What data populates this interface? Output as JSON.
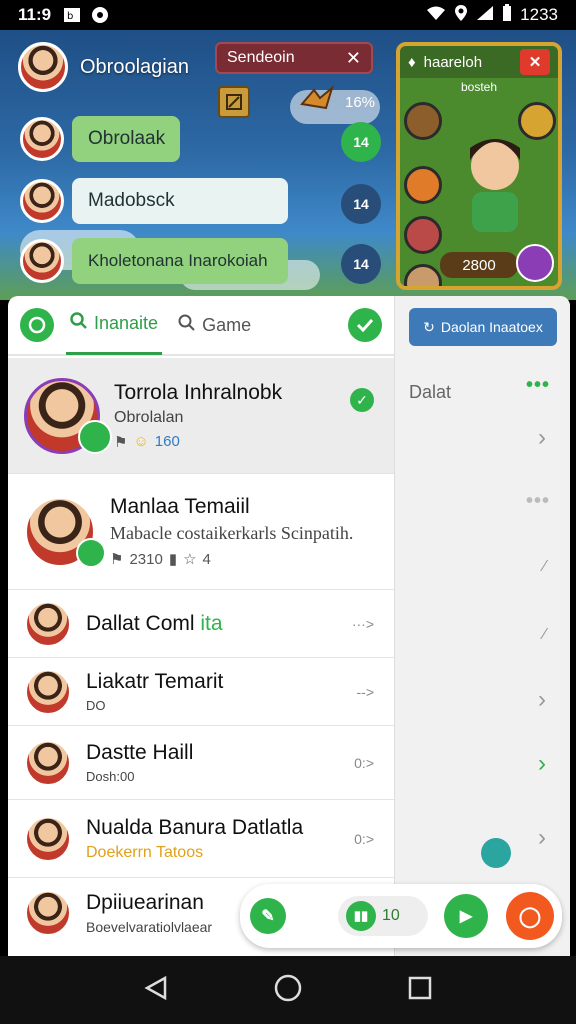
{
  "status_bar": {
    "time": "11:9",
    "right_text": "1233",
    "icons": [
      "app-icon",
      "circle-dot-icon",
      "wifi-icon",
      "location-icon",
      "signal-icon",
      "battery-icon"
    ]
  },
  "game": {
    "profile_name": "Obroolagian",
    "session_label": "Sendeoin",
    "percent": "16%",
    "chats": [
      {
        "label": "Obrolaak",
        "count": "14"
      },
      {
        "label": "Madobsck",
        "count": "14"
      },
      {
        "label": "Kholetonana Inarokoiah",
        "count": "14"
      }
    ],
    "panel": {
      "title": "haareloh",
      "subtitle": "bosteh",
      "score": "2800"
    }
  },
  "tabs": [
    {
      "label": "Inanaite",
      "active": true
    },
    {
      "label": "Game",
      "active": false
    }
  ],
  "right_button": "Daolan Inaatoex",
  "right_label": "Dalat",
  "list": [
    {
      "title": "Torrola Inhralnobk",
      "subtitle": "Obrolalan",
      "stats": "160"
    },
    {
      "title": "Manlaa Temaiil",
      "subtitle": "Mabacle costaikerkarls Scinpatih.",
      "stats_a": "2310",
      "stats_b": "4"
    },
    {
      "title": "Dallat Coml",
      "accent": "ita",
      "suffix": "···>"
    },
    {
      "title": "Liakatr Temarit",
      "subtitle": "DO",
      "suffix": "-->"
    },
    {
      "title": "Dastte Haill",
      "subtitle": "Dosh:00",
      "suffix": "0:>"
    },
    {
      "title": "Nualda Banura Datlatla",
      "subtitle": "Doekerrn Tatoos",
      "suffix": "0:>"
    },
    {
      "title": "Dpiiuearinan",
      "subtitle": "Boevelvaratiolvlaear"
    }
  ],
  "bottom_bar": {
    "pill_value": "10"
  },
  "colors": {
    "accent_green": "#2fb34b",
    "blue": "#3f7ab8",
    "orange": "#f2591f"
  }
}
